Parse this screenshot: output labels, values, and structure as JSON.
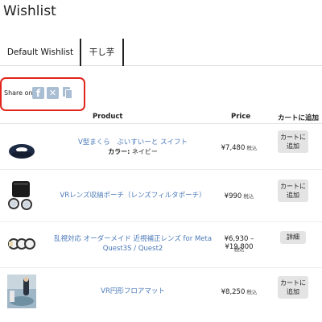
{
  "page": {
    "title": "Wishlist"
  },
  "tabs": [
    {
      "label": "Default Wishlist"
    },
    {
      "label": "干し芋"
    }
  ],
  "share": {
    "label": "Share on",
    "icons": [
      "facebook-icon",
      "x-icon",
      "copy-link-icon"
    ],
    "icon_color": "#a9bdd3",
    "highlight_color": "#e0261c"
  },
  "table": {
    "headers": {
      "product": "Product",
      "price": "Price",
      "cart": "カートに追加"
    },
    "rows": [
      {
        "name": "V型まくら　ぶいすいーと スイフト",
        "variant_label": "カラー:",
        "variant_value": "ネイビー",
        "price": "¥7,480",
        "tax": "税込",
        "action": "カートに追加"
      },
      {
        "name": "VRレンズ収納ポーチ（レンズフィルタポーチ）",
        "price": "¥990",
        "tax": "税込",
        "action": "カートに追加"
      },
      {
        "name_line1": "乱視対応 オーダーメイド 近視補正レンズ for Meta",
        "name_line2": "Quest3S / Quest2",
        "price": "¥6,930 – ¥19,800",
        "tax": "税込",
        "action": "詳細"
      },
      {
        "name": "VR円形フロアマット",
        "price": "¥8,250",
        "tax": "税込",
        "action": "カートに追加"
      }
    ]
  },
  "colors": {
    "link": "#4a78b8",
    "button_bg": "#e4e4e4"
  }
}
